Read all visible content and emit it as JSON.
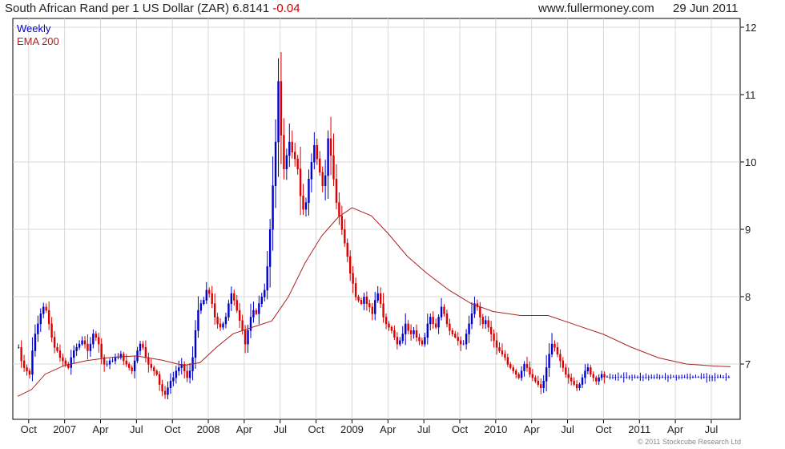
{
  "header": {
    "title": "South African Rand per 1 US Dollar (ZAR) 6.8141",
    "change": "-0.04",
    "site": "www.fullermoney.com",
    "date": "29 Jun 2011"
  },
  "copyright": "© 2011 Stockcube Research Ltd",
  "colors": {
    "up": "#0000cc",
    "down": "#dd0000",
    "ema": "#aa2222",
    "grid": "#d8d8d8"
  },
  "chart_data": {
    "type": "candlestick",
    "legend": [
      "Weekly",
      "EMA 200"
    ],
    "legend_position": "top-left",
    "grid": true,
    "ylim": [
      6.35,
      12.1
    ],
    "y_ticks": [
      7,
      8,
      9,
      10,
      11,
      12
    ],
    "y_axis_side": "right",
    "x_ticks": [
      "Oct",
      "2007",
      "Apr",
      "Jul",
      "Oct",
      "2008",
      "Apr",
      "Jul",
      "Oct",
      "2009",
      "Apr",
      "Jul",
      "Oct",
      "2010",
      "Apr",
      "Jul",
      "Oct",
      "2011",
      "Apr",
      "Jul"
    ],
    "x_tick_weeks": [
      4,
      17,
      30,
      43,
      56,
      69,
      82,
      95,
      108,
      121,
      134,
      147,
      160,
      173,
      186,
      199,
      212,
      225,
      238,
      251
    ],
    "weeks": 258,
    "weekly_close": [
      7.25,
      7.05,
      6.95,
      6.9,
      6.85,
      7.2,
      7.45,
      7.6,
      7.75,
      7.85,
      7.8,
      7.6,
      7.4,
      7.25,
      7.2,
      7.1,
      7.05,
      7.0,
      6.95,
      7.1,
      7.2,
      7.25,
      7.3,
      7.35,
      7.3,
      7.2,
      7.3,
      7.45,
      7.4,
      7.3,
      7.1,
      7.0,
      7.0,
      7.05,
      7.05,
      7.1,
      7.1,
      7.15,
      7.05,
      7.0,
      6.95,
      6.9,
      7.05,
      7.2,
      7.3,
      7.25,
      7.1,
      7.0,
      6.95,
      6.9,
      6.85,
      6.7,
      6.6,
      6.55,
      6.65,
      6.75,
      6.8,
      6.9,
      6.95,
      7.0,
      6.9,
      6.8,
      6.9,
      7.1,
      7.5,
      7.8,
      7.9,
      7.95,
      8.1,
      8.05,
      7.9,
      7.7,
      7.6,
      7.55,
      7.6,
      7.7,
      7.9,
      8.05,
      7.95,
      7.8,
      7.65,
      7.5,
      7.3,
      7.5,
      7.7,
      7.8,
      7.75,
      7.9,
      8.0,
      8.1,
      8.45,
      9.0,
      9.65,
      10.3,
      11.2,
      10.4,
      9.9,
      10.1,
      10.3,
      10.15,
      10.05,
      9.9,
      9.5,
      9.3,
      9.4,
      9.75,
      10.0,
      10.25,
      10.05,
      9.85,
      9.65,
      9.8,
      10.35,
      10.1,
      9.75,
      9.4,
      9.2,
      9.0,
      8.8,
      8.6,
      8.35,
      8.2,
      8.0,
      7.95,
      7.9,
      8.0,
      7.9,
      7.85,
      7.75,
      7.95,
      8.05,
      7.9,
      7.7,
      7.6,
      7.55,
      7.5,
      7.4,
      7.3,
      7.35,
      7.45,
      7.6,
      7.5,
      7.45,
      7.5,
      7.4,
      7.35,
      7.3,
      7.4,
      7.6,
      7.7,
      7.6,
      7.55,
      7.7,
      7.85,
      7.75,
      7.6,
      7.5,
      7.45,
      7.4,
      7.35,
      7.3,
      7.3,
      7.45,
      7.6,
      7.75,
      7.9,
      7.85,
      7.7,
      7.6,
      7.65,
      7.55,
      7.45,
      7.35,
      7.25,
      7.2,
      7.15,
      7.1,
      7.0,
      6.95,
      6.9,
      6.85,
      6.8,
      6.9,
      7.0,
      6.95,
      6.85,
      6.8,
      6.75,
      6.7,
      6.65,
      6.75,
      6.95,
      7.15,
      7.3,
      7.25,
      7.15,
      7.05,
      6.95,
      6.85,
      6.8,
      6.75,
      6.7,
      6.65,
      6.7,
      6.8,
      6.9,
      6.95,
      6.85,
      6.8,
      6.75,
      6.8,
      6.85,
      6.81
    ],
    "ema_200": [
      [
        0,
        6.52
      ],
      [
        5,
        6.62
      ],
      [
        10,
        6.85
      ],
      [
        17,
        6.98
      ],
      [
        25,
        7.05
      ],
      [
        34,
        7.1
      ],
      [
        43,
        7.12
      ],
      [
        52,
        7.06
      ],
      [
        60,
        6.98
      ],
      [
        66,
        7.02
      ],
      [
        72,
        7.25
      ],
      [
        78,
        7.45
      ],
      [
        86,
        7.56
      ],
      [
        92,
        7.64
      ],
      [
        98,
        8.0
      ],
      [
        104,
        8.5
      ],
      [
        110,
        8.9
      ],
      [
        116,
        9.18
      ],
      [
        121,
        9.32
      ],
      [
        128,
        9.2
      ],
      [
        134,
        8.94
      ],
      [
        141,
        8.6
      ],
      [
        148,
        8.35
      ],
      [
        156,
        8.1
      ],
      [
        164,
        7.9
      ],
      [
        172,
        7.78
      ],
      [
        182,
        7.72
      ],
      [
        192,
        7.72
      ],
      [
        202,
        7.58
      ],
      [
        212,
        7.44
      ],
      [
        222,
        7.25
      ],
      [
        232,
        7.09
      ],
      [
        242,
        7.0
      ],
      [
        252,
        6.97
      ],
      [
        258,
        6.96
      ]
    ]
  }
}
